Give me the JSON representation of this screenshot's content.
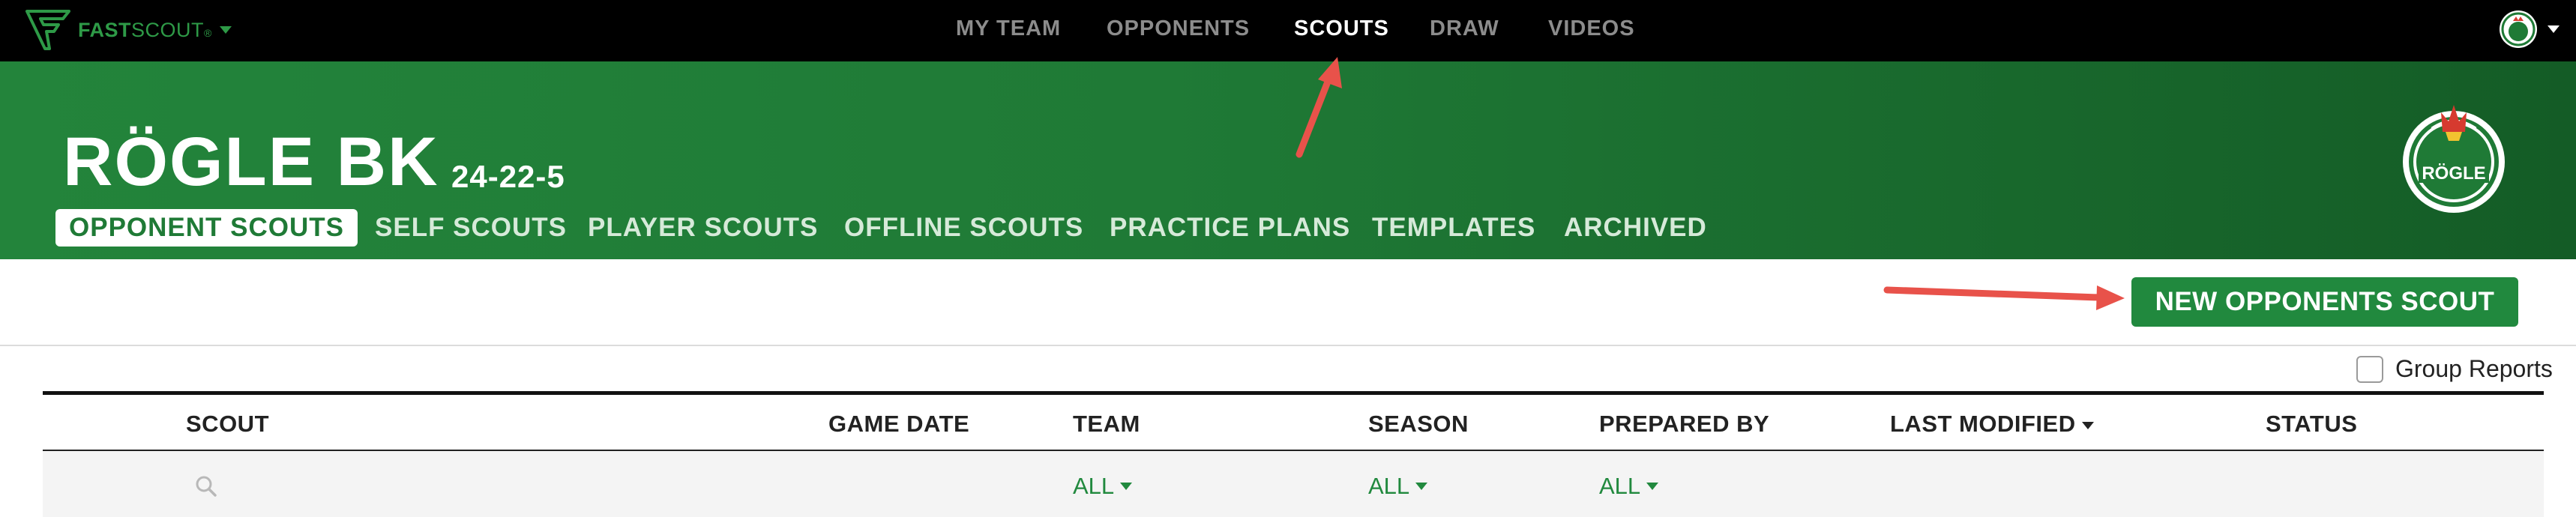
{
  "topbar": {
    "logo_bold": "FAST",
    "logo_light": "SCOUT",
    "logo_mark": "®",
    "nav": [
      {
        "label": "MY TEAM",
        "active": false
      },
      {
        "label": "OPPONENTS",
        "active": false
      },
      {
        "label": "SCOUTS",
        "active": true
      },
      {
        "label": "DRAW",
        "active": false
      },
      {
        "label": "VIDEOS",
        "active": false
      }
    ]
  },
  "header": {
    "team_name": "RÖGLE BK",
    "record": "24-22-5",
    "tabs": [
      {
        "label": "OPPONENT SCOUTS",
        "active": true
      },
      {
        "label": "SELF SCOUTS",
        "active": false
      },
      {
        "label": "PLAYER SCOUTS",
        "active": false
      },
      {
        "label": "OFFLINE SCOUTS",
        "active": false
      },
      {
        "label": "PRACTICE PLANS",
        "active": false
      },
      {
        "label": "TEMPLATES",
        "active": false
      },
      {
        "label": "ARCHIVED",
        "active": false
      }
    ],
    "crest_text": "RÖGLE"
  },
  "toolbar": {
    "new_button_label": "NEW OPPONENTS SCOUT",
    "group_reports_label": "Group Reports",
    "group_reports_checked": false
  },
  "table": {
    "columns": [
      {
        "label": "SCOUT"
      },
      {
        "label": "GAME DATE"
      },
      {
        "label": "TEAM"
      },
      {
        "label": "SEASON"
      },
      {
        "label": "PREPARED BY"
      },
      {
        "label": "LAST MODIFIED",
        "sorted": "desc"
      },
      {
        "label": "STATUS"
      }
    ],
    "filters": {
      "team": "ALL",
      "season": "ALL",
      "prepared_by": "ALL"
    }
  },
  "colors": {
    "brand_green": "#21893e",
    "header_green_dark": "#145c26",
    "annotation_red": "#e8524a"
  }
}
